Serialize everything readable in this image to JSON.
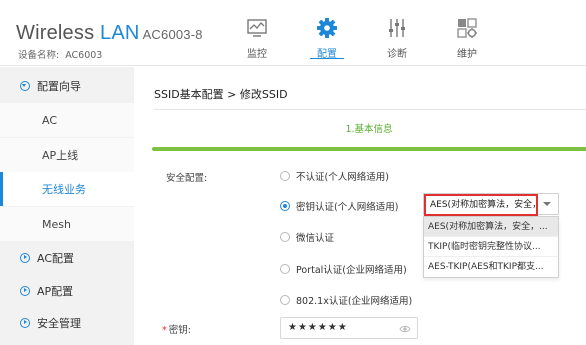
{
  "header": {
    "brand_part1": "Wireless",
    "brand_part2": "LAN",
    "model": "AC6003-8",
    "device_label": "设备名称:",
    "device_name": "AC6003",
    "accent_color": "#1e88d8",
    "nav": [
      {
        "label": "监控",
        "icon": "monitor-icon",
        "active": false
      },
      {
        "label": "配置",
        "icon": "gear-icon",
        "active": true
      },
      {
        "label": "诊断",
        "icon": "sliders-icon",
        "active": false
      },
      {
        "label": "维护",
        "icon": "maintenance-icon",
        "active": false
      }
    ]
  },
  "sidebar": {
    "items": [
      {
        "label": "配置向导",
        "type": "group",
        "expanded": true
      },
      {
        "label": "AC",
        "type": "sub"
      },
      {
        "label": "AP上线",
        "type": "sub"
      },
      {
        "label": "无线业务",
        "type": "sub",
        "active": true
      },
      {
        "label": "Mesh",
        "type": "sub"
      },
      {
        "label": "AC配置",
        "type": "group",
        "expanded": false
      },
      {
        "label": "AP配置",
        "type": "group",
        "expanded": false
      },
      {
        "label": "安全管理",
        "type": "group",
        "expanded": false
      }
    ]
  },
  "main": {
    "breadcrumb": "SSID基本配置 > 修改SSID",
    "step": "1.基本信息",
    "progress_color": "#7cc142",
    "security_label": "安全配置:",
    "options": [
      {
        "label": "不认证(个人网络适用)",
        "checked": false
      },
      {
        "label": "密钥认证(个人网络适用)",
        "checked": true
      },
      {
        "label": "微信认证",
        "checked": false
      },
      {
        "label": "Portal认证(企业网络适用)",
        "checked": false
      },
      {
        "label": "802.1x认证(企业网络适用)",
        "checked": false
      }
    ],
    "encryption": {
      "selected": "AES(对称加密算法，安全，",
      "options": [
        {
          "label": "AES(对称加密算法，安全，...",
          "highlighted": true
        },
        {
          "label": "TKIP(临时密钥完整性协议...",
          "highlighted": false
        },
        {
          "label": "AES-TKIP(AES和TKIP都支...",
          "highlighted": false
        }
      ]
    },
    "password": {
      "required_mark": "*",
      "label": "密钥:",
      "value_masked": "★★★★★★"
    }
  }
}
